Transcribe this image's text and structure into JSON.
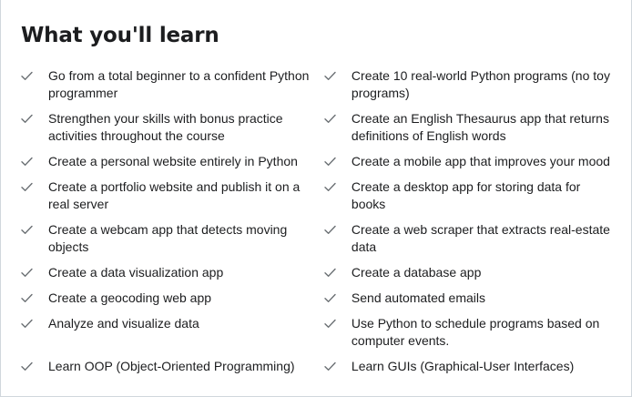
{
  "heading": "What you'll learn",
  "icon": "checkmark-icon",
  "left_items": [
    "Go from a total beginner to a confident Python programmer",
    "Strengthen your skills with bonus practice activities throughout the course",
    "Create a personal website entirely in Python",
    "Create a portfolio website and publish it on a real server",
    "Create a webcam app that detects moving objects",
    "Create a data visualization app",
    "Create a geocoding web app",
    "Analyze and visualize data",
    "Learn OOP (Object-Oriented Programming)"
  ],
  "right_items": [
    "Create 10 real-world Python programs (no toy programs)",
    "Create an English Thesaurus app that returns definitions of English words",
    "Create a mobile app that improves your mood",
    "Create a desktop app for storing data for books",
    "Create a web scraper that extracts real-estate data",
    "Create a database app",
    "Send automated emails",
    "Use Python to schedule programs based on computer events.",
    "Learn GUIs (Graphical-User Interfaces)"
  ],
  "colors": {
    "text": "#1c1d1f",
    "check": "#6a6f73",
    "border": "#d1d7dc"
  }
}
